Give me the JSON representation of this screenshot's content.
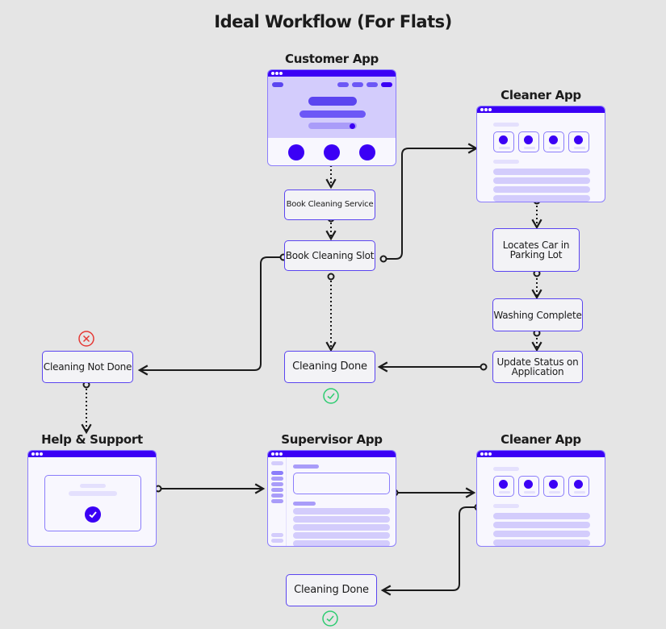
{
  "title": "Ideal Workflow (For Flats)",
  "apps": {
    "customer": {
      "label": "Customer App"
    },
    "cleaner_top": {
      "label": "Cleaner App"
    },
    "help": {
      "label": "Help & Support"
    },
    "supervisor": {
      "label": "Supervisor App"
    },
    "cleaner_bottom": {
      "label": "Cleaner App"
    }
  },
  "steps": {
    "book_service": "Book Cleaning Service",
    "book_slot": "Book Cleaning Slot",
    "locates_car": "Locates Car in Parking Lot",
    "washing_complete": "Washing Complete",
    "update_status": "Update Status on Application",
    "cleaning_done_top": "Cleaning Done",
    "cleaning_not_done": "Cleaning Not Done",
    "cleaning_done_bottom": "Cleaning Done"
  },
  "status_icons": {
    "fail": {
      "icon": "x-circle-icon",
      "color": "#e53935"
    },
    "success": {
      "icon": "check-circle-icon",
      "color": "#2ecc71"
    }
  },
  "colors": {
    "accent": "#3b00f5",
    "window_border": "#8b7dfb",
    "node_border": "#5b45f0",
    "background": "#e5e5e5",
    "light_fill": "#d3ccfc",
    "mid_fill": "#a99cf9"
  }
}
